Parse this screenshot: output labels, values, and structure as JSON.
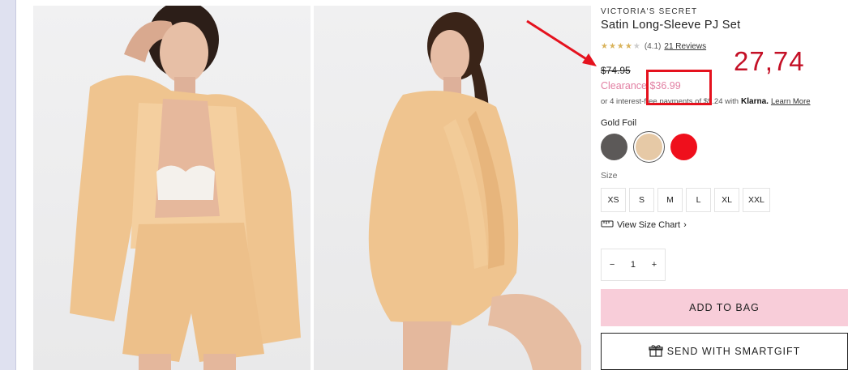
{
  "product": {
    "brand": "VICTORIA'S SECRET",
    "title": "Satin Long-Sleeve PJ Set",
    "rating_value": 4.1,
    "rating_text": "(4.1)",
    "reviews_link": "21 Reviews",
    "original_price": "$74.95",
    "clearance_label": "Clearance",
    "clearance_price": "$36.99",
    "installments_prefix": "or 4 interest-free payments of $9.24 with",
    "klarna_label": "Klarna.",
    "learn_more": "Learn More",
    "selected_color": "Gold Foil",
    "size_label": "Size",
    "sizes": [
      "XS",
      "S",
      "M",
      "L",
      "XL",
      "XXL"
    ],
    "size_chart_label": "View Size Chart",
    "quantity": "1",
    "add_to_bag": "ADD TO BAG",
    "smartgift": "SEND WITH SMARTGIFT"
  },
  "swatches": [
    {
      "name": "charcoal-swatch",
      "color": "#5c5958"
    },
    {
      "name": "gold-foil-swatch",
      "color": "#e6c9a6",
      "selected": true
    },
    {
      "name": "red-swatch",
      "color": "#ef0f1c"
    }
  ],
  "colors": {
    "clearance": "#e27fa2",
    "add_to_bag": "#f8cdd9",
    "annotation": "#e5121e",
    "satin": "#efc48f"
  },
  "annotation": {
    "note": "27,74"
  }
}
